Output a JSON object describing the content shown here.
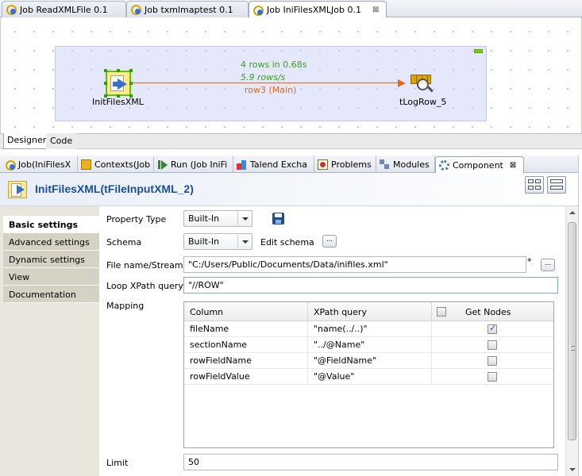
{
  "editor_tabs": [
    {
      "label": "Job ReadXMLFile 0.1"
    },
    {
      "label": "Job txmlmaptest 0.1"
    },
    {
      "label": "Job IniFilesXMLJob 0.1",
      "close": "⊠"
    }
  ],
  "designer": {
    "source_component": "InitFilesXML",
    "target_component": "tLogRow_5",
    "flow_stats_rows": "4 rows in 0.68s",
    "flow_stats_rate": "5.9 rows/s",
    "flow_label": "row3 (Main)",
    "tabs": [
      "Designer",
      "Code"
    ]
  },
  "view_tabs": [
    {
      "label": "Job(IniFilesX",
      "icon": "job-icon"
    },
    {
      "label": "Contexts(Job",
      "icon": "contexts-icon"
    },
    {
      "label": "Run (Job IniFi",
      "icon": "run-icon"
    },
    {
      "label": "Talend Excha",
      "icon": "exchange-icon"
    },
    {
      "label": "Problems",
      "icon": "problems-icon"
    },
    {
      "label": "Modules",
      "icon": "modules-icon"
    },
    {
      "label": "Component",
      "icon": "component-icon",
      "close": "⊠"
    }
  ],
  "component": {
    "title": "InitFilesXML(tFileInputXML_2)"
  },
  "sidebar": {
    "items": [
      {
        "label": "Basic settings"
      },
      {
        "label": "Advanced settings"
      },
      {
        "label": "Dynamic settings"
      },
      {
        "label": "View"
      },
      {
        "label": "Documentation"
      }
    ]
  },
  "form": {
    "property_type_label": "Property Type",
    "property_type_value": "Built-In",
    "schema_label": "Schema",
    "schema_value": "Built-In",
    "edit_schema_label": "Edit schema",
    "ellipsis": "...",
    "file_name_label": "File name/Stream",
    "file_name_value": "\"C:/Users/Public/Documents/Data/inifiles.xml\"",
    "required_mark": "*",
    "loop_xpath_label": "Loop XPath query",
    "loop_xpath_value": "\"//ROW\"",
    "mapping_label": "Mapping",
    "limit_label": "Limit",
    "limit_value": "50"
  },
  "mapping": {
    "columns": [
      "Column",
      "XPath query",
      "Get Nodes"
    ],
    "rows": [
      {
        "column": "fileName",
        "xpath": "\"name(../..)\"",
        "get_nodes": true
      },
      {
        "column": "sectionName",
        "xpath": "\"../@Name\"",
        "get_nodes": false
      },
      {
        "column": "rowFieldName",
        "xpath": "\"@FieldName\"",
        "get_nodes": false
      },
      {
        "column": "rowFieldValue",
        "xpath": "\"@Value\"",
        "get_nodes": false
      }
    ]
  }
}
